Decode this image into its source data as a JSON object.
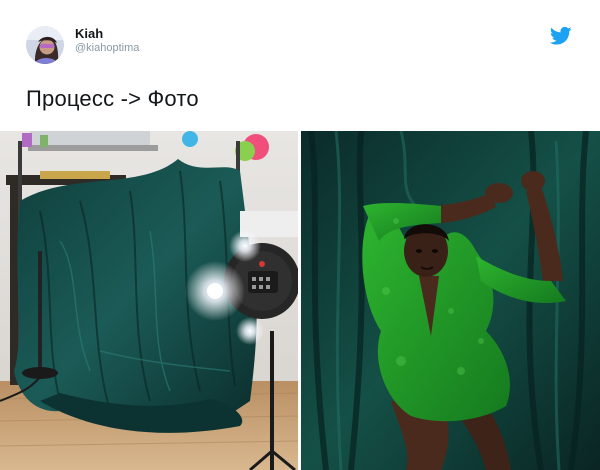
{
  "user": {
    "display_name": "Kiah",
    "username": "@kiahoptima"
  },
  "tweet": {
    "text": "Процесс -> Фото"
  },
  "icons": {
    "brand": "twitter-bird-icon",
    "brand_color": "#1da1f2"
  },
  "colors": {
    "backdrop": "#0f3b36",
    "dress": "#1f9a2a"
  }
}
